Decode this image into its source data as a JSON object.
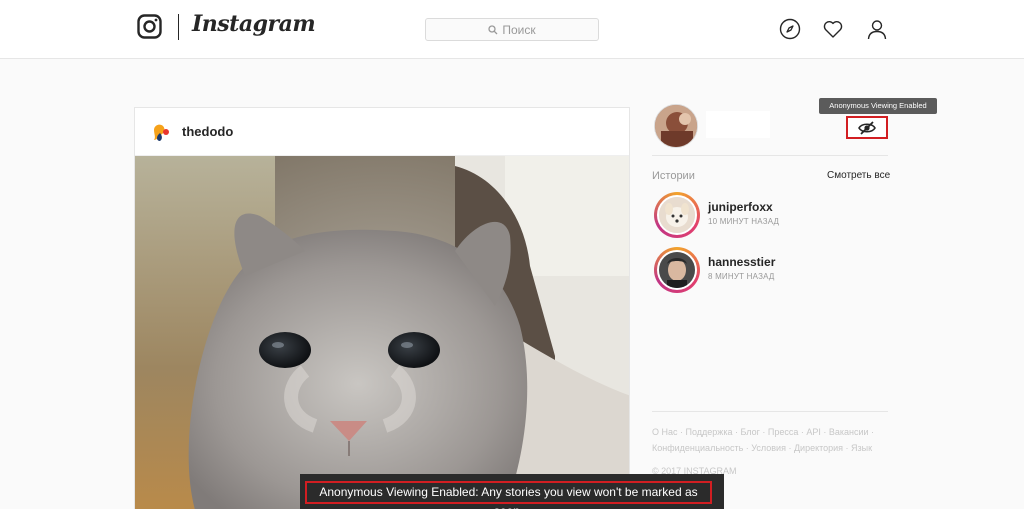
{
  "header": {
    "brand": "Instagram",
    "search_placeholder": "Поиск"
  },
  "post": {
    "username": "thedodo"
  },
  "sidebar": {
    "tooltip": "Anonymous Viewing Enabled",
    "stories_title": "Истории",
    "see_all": "Смотреть все",
    "stories": [
      {
        "username": "juniperfoxx",
        "time": "10 МИНУТ НАЗАД"
      },
      {
        "username": "hannesstier",
        "time": "8 МИНУТ НАЗАД"
      }
    ],
    "footer": {
      "links": [
        "О Нас",
        "Поддержка",
        "Блог",
        "Пресса",
        "API",
        "Вакансии",
        "Конфиденциальность",
        "Условия",
        "Директория",
        "Язык"
      ],
      "links_line1": "О Нас · Поддержка · Блог · Пресса · API · Вакансии ·",
      "links_line2": "Конфиденциальность · Условия · Директория · Язык",
      "copyright": "© 2017 INSTAGRAM"
    }
  },
  "banner": {
    "text": "Anonymous Viewing Enabled: Any stories you view won't be marked as seen."
  },
  "colors": {
    "accent_red": "#d21e22",
    "story_ring": "#e23f6d",
    "banner_bg": "#2b2b2b"
  }
}
